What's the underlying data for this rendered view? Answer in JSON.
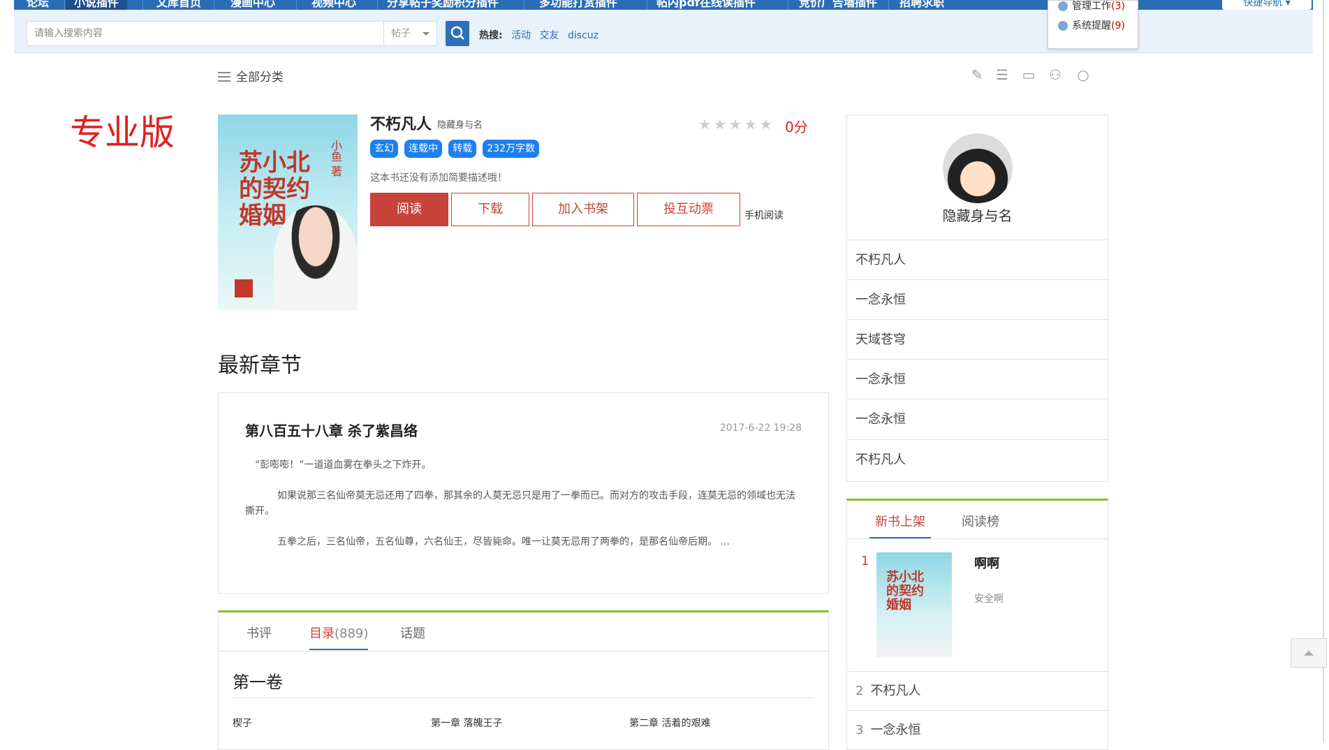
{
  "topnav": {
    "items": [
      "论坛",
      "小说插件",
      "文库首页",
      "漫画中心",
      "视频中心",
      "分享帖子奖励积分插件",
      "多功能打赏插件",
      "帖内pdf在线读插件",
      "竞价广告墙插件",
      "招聘求职"
    ],
    "quick_nav": "快捷导航"
  },
  "popover": {
    "manage_label": "管理工作",
    "manage_count": "(3)",
    "remind_label": "系统提醒",
    "remind_count": "(9)"
  },
  "search": {
    "placeholder": "请输入搜索内容",
    "type": "帖子",
    "hot_label": "热搜:",
    "hot_items": [
      "活动",
      "交友",
      "discuz"
    ]
  },
  "category_label": "全部分类",
  "pro_label": "专业版",
  "book": {
    "title": "不朽凡人",
    "author": "隐藏身与名",
    "score": "0分",
    "tags": [
      "玄幻",
      "连载中",
      "转载",
      "232万字数"
    ],
    "description": "这本书还没有添加简要描述哦！",
    "cover_title": "苏小北的契约婚姻",
    "cover_author": "小鱼 著",
    "buttons": [
      "阅读",
      "下载",
      "加入书架",
      "投互动票"
    ],
    "mobile_read": "手机阅读"
  },
  "latest": {
    "heading": "最新章节",
    "chapter_title": "第八百五十八章 杀了紫昌络",
    "date": "2017-6-22 19:28",
    "paragraphs": [
      "“彭嘭嘭！”一道道血雾在拳头之下炸开。",
      "如果说那三名仙帝莫无忌还用了四拳，那其余的人莫无忌只是用了一拳而已。而对方的攻击手段，连莫无忌的领域也无法撕开。",
      "五拳之后，三名仙帝，五名仙尊，六名仙王，尽皆毙命。唯一让莫无忌用了两拳的，是那名仙帝后期。 ..."
    ]
  },
  "catalog": {
    "tabs": [
      "书评",
      "目录",
      "话题"
    ],
    "catalog_count": "(889)",
    "volume": "第一卷",
    "chapters": [
      "楔子",
      "第一章 落魄王子",
      "第二章 活着的艰难"
    ]
  },
  "sidebar": {
    "user_name": "隐藏身与名",
    "books": [
      "不朽凡人",
      "一念永恒",
      "天域苍穹",
      "一念永恒",
      "一念永恒",
      "不朽凡人"
    ]
  },
  "rank": {
    "tabs": [
      "新书上架",
      "阅读榜"
    ],
    "top": {
      "num": "1",
      "title": "啊啊",
      "sub": "安全啊",
      "cover_title": "苏小北的契约婚姻"
    },
    "rows": [
      {
        "num": "2",
        "title": "不朽凡人"
      },
      {
        "num": "3",
        "title": "一念永恒"
      }
    ]
  },
  "colors": {
    "nav_blue": "#2b6cb7",
    "accent_red": "#c8443a",
    "green_rule": "#8cbc2d",
    "tag_blue": "#1d7ff0"
  }
}
